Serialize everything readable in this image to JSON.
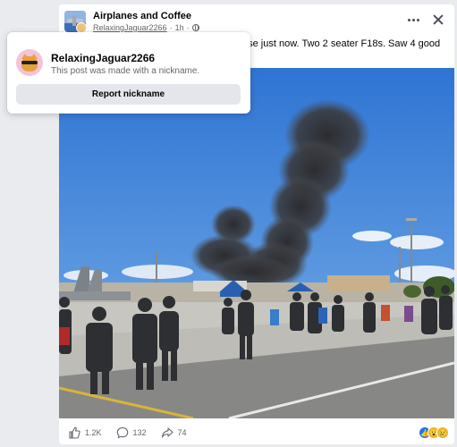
{
  "post": {
    "group_name": "Airplanes and Coffee",
    "author": "RelaxingJaguar2266",
    "time": "1h",
    "separator": "·",
    "text_visible": "ase just now. Two 2 seater F18s. Saw 4 good"
  },
  "popover": {
    "nickname": "RelaxingJaguar2266",
    "description": "This post was made with a nickname.",
    "report_label": "Report nickname"
  },
  "footer": {
    "likes": "1.2K",
    "comments": "132",
    "shares": "74"
  },
  "colors": {
    "accent": "#1877f2",
    "button_bg": "#e4e6eb",
    "text_secondary": "#65676b"
  },
  "icons": [
    "more-icon",
    "close-icon",
    "globe-icon",
    "like-icon",
    "comment-icon",
    "share-icon"
  ]
}
